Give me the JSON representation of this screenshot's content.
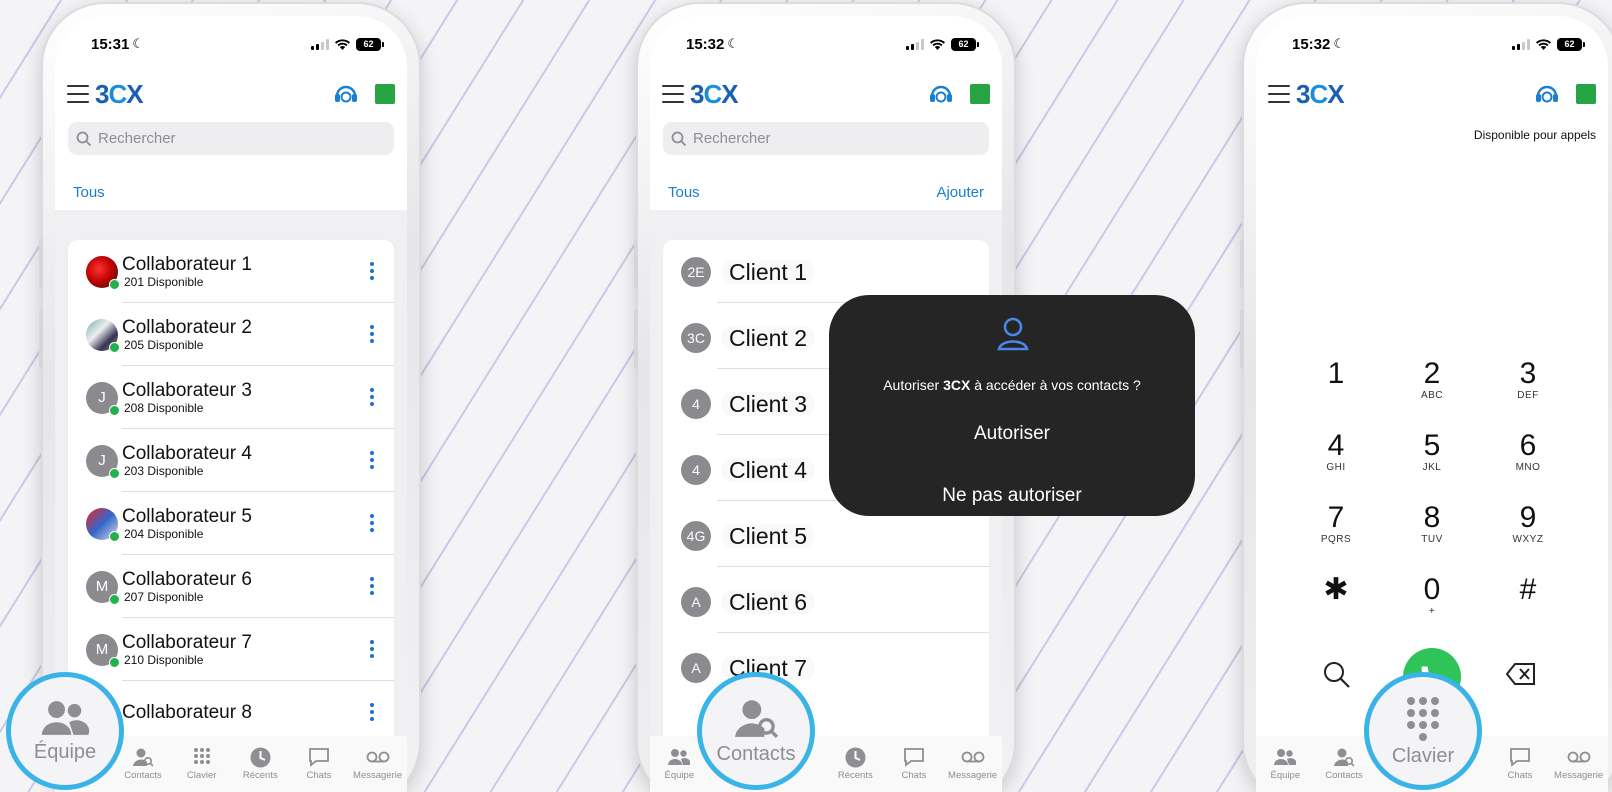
{
  "phone1": {
    "time": "15:31",
    "battery": "62",
    "search_placeholder": "Rechercher",
    "filter_label": "Tous",
    "contacts": [
      {
        "name": "Collaborateur 1",
        "sub": "201 Disponible",
        "initials": "",
        "avatar": "image"
      },
      {
        "name": "Collaborateur 2",
        "sub": "205 Disponible",
        "initials": "",
        "avatar": "image"
      },
      {
        "name": "Collaborateur 3",
        "sub": "208 Disponible",
        "initials": "J",
        "avatar": "initials"
      },
      {
        "name": "Collaborateur 4",
        "sub": "203 Disponible",
        "initials": "J",
        "avatar": "initials"
      },
      {
        "name": "Collaborateur 5",
        "sub": "204 Disponible",
        "initials": "",
        "avatar": "image"
      },
      {
        "name": "Collaborateur 6",
        "sub": "207 Disponible",
        "initials": "M",
        "avatar": "initials"
      },
      {
        "name": "Collaborateur 7",
        "sub": "210 Disponible",
        "initials": "M",
        "avatar": "initials"
      },
      {
        "name": "Collaborateur 8",
        "sub": "",
        "initials": "",
        "avatar": "initials"
      }
    ],
    "highlight_label": "Équipe"
  },
  "phone2": {
    "time": "15:32",
    "battery": "62",
    "search_placeholder": "Rechercher",
    "filter_label": "Tous",
    "add_label": "Ajouter",
    "contacts": [
      {
        "name": "Client 1",
        "initials": "2E"
      },
      {
        "name": "Client 2",
        "initials": "3C"
      },
      {
        "name": "Client 3",
        "initials": "4"
      },
      {
        "name": "Client 4",
        "initials": "4"
      },
      {
        "name": "Client 5",
        "initials": "4G"
      },
      {
        "name": "Client 6",
        "initials": "A"
      },
      {
        "name": "Client 7",
        "initials": "A"
      }
    ],
    "highlight_label": "Contacts"
  },
  "dialog": {
    "question_pre": "Autoriser ",
    "question_app": "3CX",
    "question_post": " à accéder à vos contacts ?",
    "allow": "Autoriser",
    "deny": "Ne pas autoriser"
  },
  "phone3": {
    "time": "15:32",
    "battery": "62",
    "availability": "Disponible pour appels",
    "keys": [
      {
        "n": "1",
        "l": ""
      },
      {
        "n": "2",
        "l": "ABC"
      },
      {
        "n": "3",
        "l": "DEF"
      },
      {
        "n": "4",
        "l": "GHI"
      },
      {
        "n": "5",
        "l": "JKL"
      },
      {
        "n": "6",
        "l": "MNO"
      },
      {
        "n": "7",
        "l": "PQRS"
      },
      {
        "n": "8",
        "l": "TUV"
      },
      {
        "n": "9",
        "l": "WXYZ"
      },
      {
        "n": "✱",
        "l": ""
      },
      {
        "n": "0",
        "l": "+"
      },
      {
        "n": "#",
        "l": ""
      }
    ],
    "highlight_label": "Clavier"
  },
  "logo": {
    "a": "3",
    "b": "C",
    "c": "X"
  },
  "tabbar": {
    "equipe": "Équipe",
    "contacts": "Contacts",
    "clavier": "Clavier",
    "recents": "Récents",
    "chats": "Chats",
    "messagerie": "Messagerie"
  },
  "colors": {
    "accent": "#1a7fd0",
    "status_green": "#27a544",
    "call_green": "#2ec45a",
    "highlight_ring": "#3ab4e6"
  }
}
